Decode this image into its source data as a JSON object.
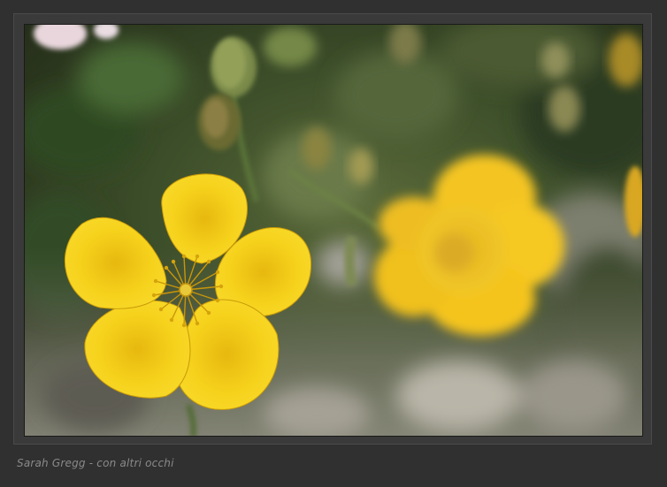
{
  "caption": "Sarah Gregg - con altri occhi",
  "colors": {
    "background": "#303030",
    "frame": "#3a3a3a",
    "petal": "#f2cc1a",
    "petal_shadow": "#d8a90c",
    "foliage": "#3f5a2a",
    "caption_text": "#8a8a8a"
  }
}
